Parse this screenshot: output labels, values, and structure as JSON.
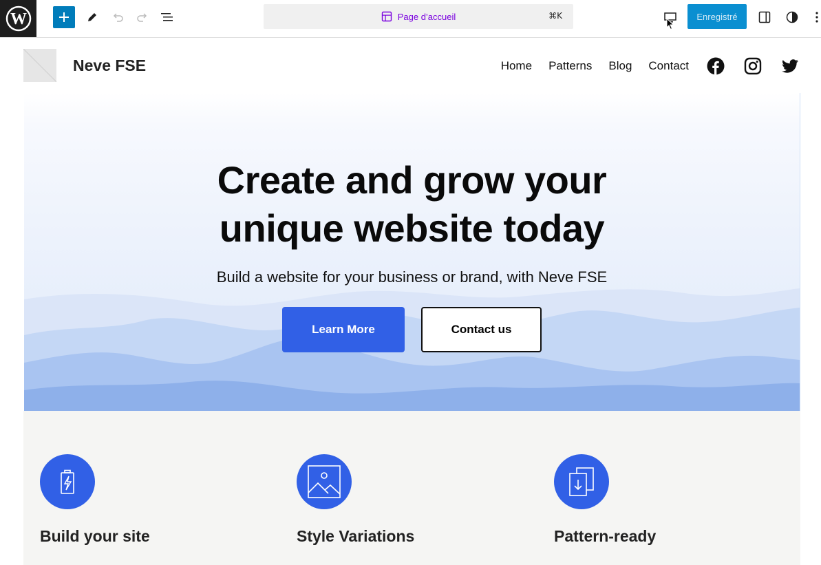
{
  "toolbar": {
    "page_title": "Page d’accueil",
    "shortcut": "⌘K",
    "save_label": "Enregistré",
    "colors": {
      "accent": "#007cba",
      "save": "#0a8fd1",
      "page_title": "#7a00df"
    },
    "icons": [
      "wordpress-logo-icon",
      "plus-icon",
      "pencil-icon",
      "undo-icon",
      "redo-icon",
      "list-view-icon",
      "page-template-icon",
      "desktop-preview-icon",
      "sidebar-settings-icon",
      "half-circle-styles-icon",
      "more-vertical-icon"
    ]
  },
  "site": {
    "title": "Neve FSE",
    "nav": [
      "Home",
      "Patterns",
      "Blog",
      "Contact"
    ],
    "social": [
      "facebook-icon",
      "instagram-icon",
      "twitter-icon"
    ]
  },
  "hero": {
    "title_line1": "Create and grow your",
    "title_line2": "unique website today",
    "subtitle": "Build a website for your business or brand, with Neve FSE",
    "primary_button": "Learn More",
    "secondary_button": "Contact us",
    "colors": {
      "primary": "#3160e6"
    }
  },
  "features": [
    {
      "title": "Build your site",
      "icon": "battery-bolt-icon"
    },
    {
      "title": "Style Variations",
      "icon": "image-icon"
    },
    {
      "title": "Pattern-ready",
      "icon": "document-download-icon"
    }
  ]
}
